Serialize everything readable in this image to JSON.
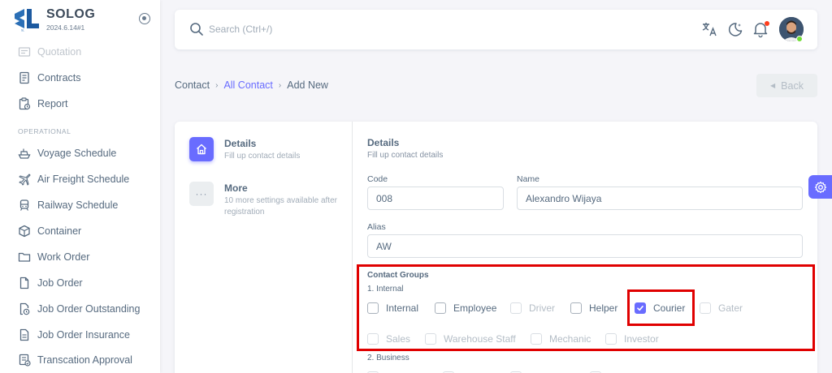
{
  "brand": {
    "name": "SOLOG",
    "version": "2024.6.14#1",
    "logo_text": "SL"
  },
  "sidebar": {
    "items_top": [
      {
        "label": "Quotation",
        "icon": "quotation-icon"
      },
      {
        "label": "Contracts",
        "icon": "contracts-icon"
      },
      {
        "label": "Report",
        "icon": "report-icon"
      }
    ],
    "section_header": "OPERATIONAL",
    "items": [
      {
        "label": "Voyage Schedule",
        "icon": "ship-icon"
      },
      {
        "label": "Air Freight Schedule",
        "icon": "plane-icon"
      },
      {
        "label": "Railway Schedule",
        "icon": "train-icon"
      },
      {
        "label": "Container",
        "icon": "container-icon"
      },
      {
        "label": "Work Order",
        "icon": "folder-icon"
      },
      {
        "label": "Job Order",
        "icon": "file-icon"
      },
      {
        "label": "Job Order Outstanding",
        "icon": "file-clock-icon"
      },
      {
        "label": "Job Order Insurance",
        "icon": "file-text-icon"
      },
      {
        "label": "Transcation Approval",
        "icon": "approval-icon"
      }
    ]
  },
  "search": {
    "placeholder": "Search (Ctrl+/)"
  },
  "breadcrumb": {
    "root": "Contact",
    "parent": "All Contact",
    "current": "Add New"
  },
  "back_button": {
    "label": "Back"
  },
  "steps": [
    {
      "title": "Details",
      "subtitle": "Fill up contact details",
      "icon": "home-icon"
    },
    {
      "title": "More",
      "subtitle": "10 more settings available after registration",
      "icon": "more-dots-icon"
    }
  ],
  "form": {
    "section_title": "Details",
    "section_subtitle": "Fill up contact details",
    "code": {
      "label": "Code",
      "value": "008"
    },
    "name": {
      "label": "Name",
      "value": "Alexandro Wijaya"
    },
    "alias": {
      "label": "Alias",
      "value": "AW"
    },
    "groups_title": "Contact Groups",
    "internal_label": "1. Internal",
    "internal_row1": [
      {
        "label": "Internal",
        "checked": false,
        "disabled": false
      },
      {
        "label": "Employee",
        "checked": false,
        "disabled": false
      },
      {
        "label": "Driver",
        "checked": false,
        "disabled": true
      },
      {
        "label": "Helper",
        "checked": false,
        "disabled": false
      },
      {
        "label": "Courier",
        "checked": true,
        "disabled": false
      },
      {
        "label": "Gater",
        "checked": false,
        "disabled": true
      }
    ],
    "internal_row2": [
      {
        "label": "Sales",
        "checked": false,
        "disabled": true
      },
      {
        "label": "Warehouse Staff",
        "checked": false,
        "disabled": true
      },
      {
        "label": "Mechanic",
        "checked": false,
        "disabled": true
      },
      {
        "label": "Investor",
        "checked": false,
        "disabled": true
      }
    ],
    "business_label": "2. Business"
  },
  "colors": {
    "primary": "#696cff",
    "highlight": "#e00000",
    "online": "#71dd37",
    "notification": "#ff3e1d"
  }
}
